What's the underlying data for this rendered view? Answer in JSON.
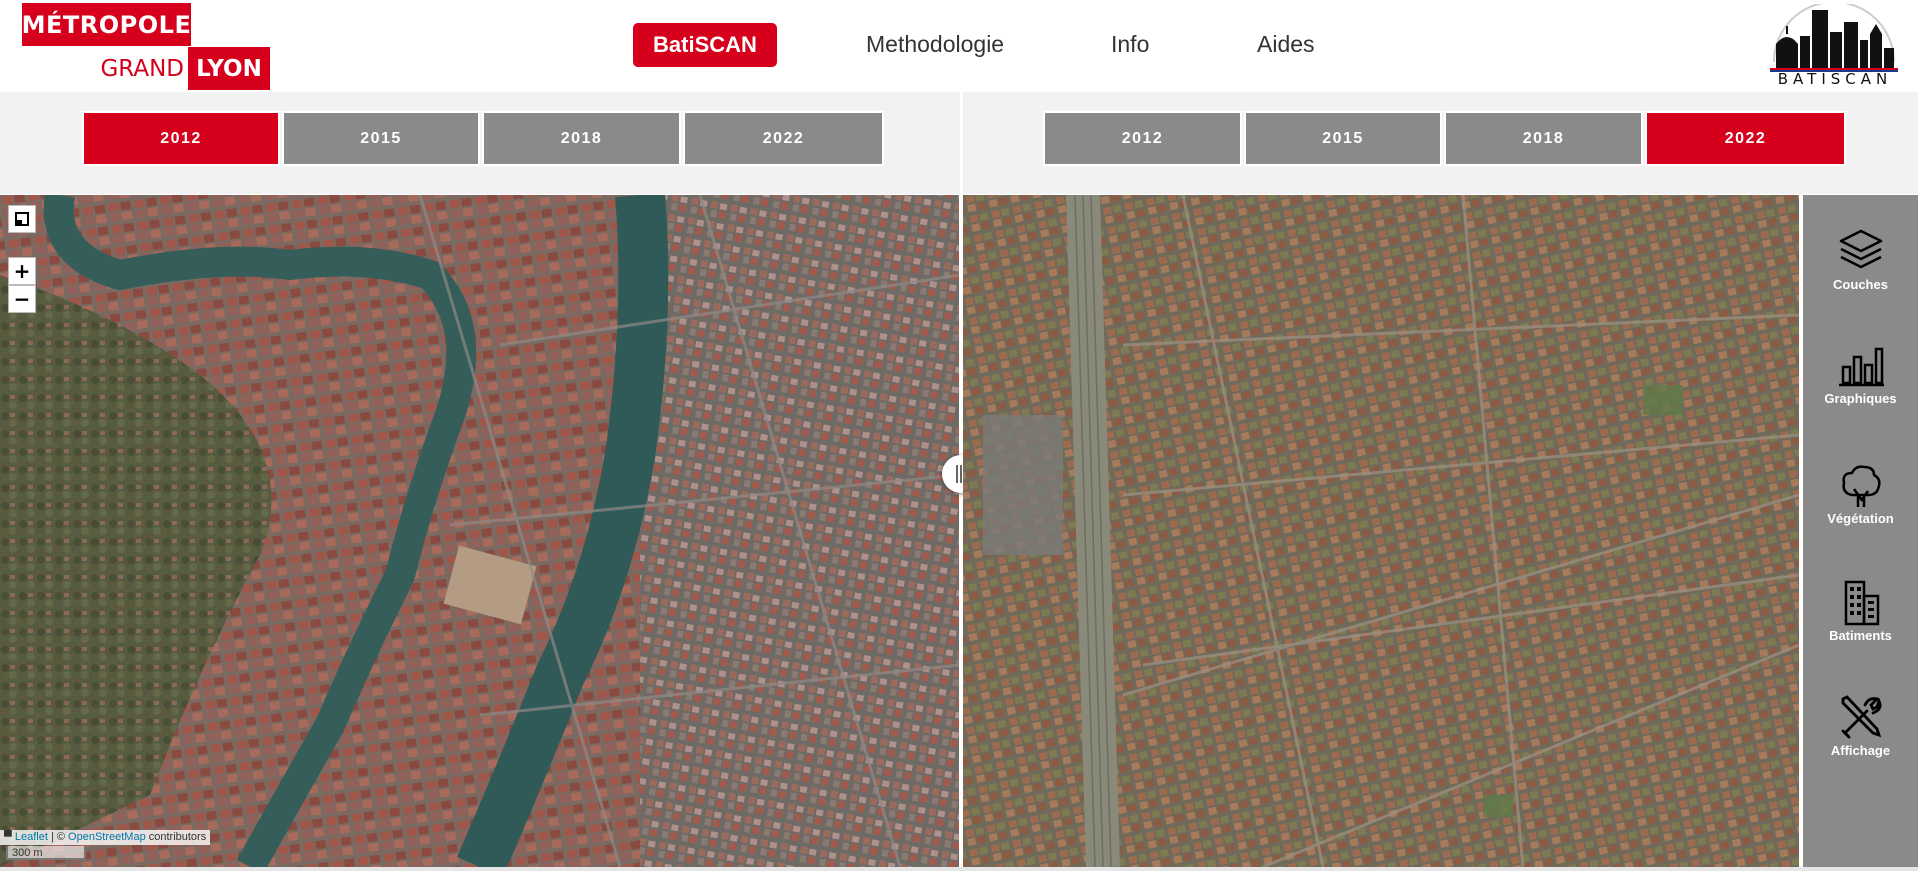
{
  "header": {
    "logo": {
      "line1": "MÉTROPOLE",
      "line2": "GRAND",
      "line3": "LYON"
    },
    "nav": {
      "active": "BatiSCAN",
      "links": [
        "Methodologie",
        "Info",
        "Aides"
      ]
    },
    "brand_text": "BATISCAN"
  },
  "left_panel": {
    "years": [
      "2012",
      "2015",
      "2018",
      "2022"
    ],
    "selected_year": "2012"
  },
  "right_panel": {
    "years": [
      "2012",
      "2015",
      "2018",
      "2022"
    ],
    "selected_year": "2022"
  },
  "map": {
    "zoom_in": "+",
    "zoom_out": "−",
    "attribution": {
      "leaflet": "Leaflet",
      "separator": " | © ",
      "osm": "OpenStreetMap",
      "suffix": " contributors"
    },
    "scale": "300 m"
  },
  "sidebar": {
    "tools": [
      {
        "label": "Couches",
        "icon": "layers-icon"
      },
      {
        "label": "Graphiques",
        "icon": "bar-chart-icon"
      },
      {
        "label": "Végétation",
        "icon": "tree-icon"
      },
      {
        "label": "Batiments",
        "icon": "building-icon"
      },
      {
        "label": "Affichage",
        "icon": "tools-icon"
      }
    ]
  },
  "colors": {
    "accent": "#d6001c",
    "inactive": "#8a8a8a",
    "river": "#355e5a"
  }
}
